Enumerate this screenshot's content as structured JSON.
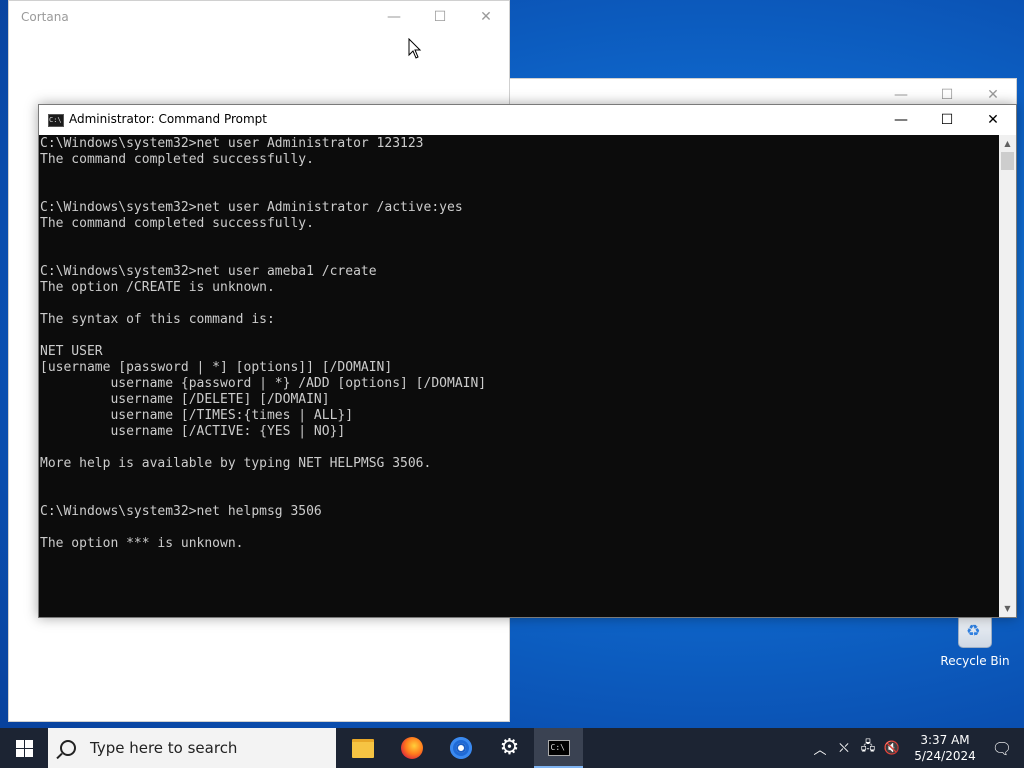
{
  "desktop": {
    "recycle_bin_label": "Recycle Bin"
  },
  "cortana_window": {
    "title": "Cortana"
  },
  "cmd_window": {
    "title": "Administrator: Command Prompt",
    "lines": [
      "C:\\Windows\\system32>net user Administrator 123123",
      "The command completed successfully.",
      "",
      "",
      "C:\\Windows\\system32>net user Administrator /active:yes",
      "The command completed successfully.",
      "",
      "",
      "C:\\Windows\\system32>net user ameba1 /create",
      "The option /CREATE is unknown.",
      "",
      "The syntax of this command is:",
      "",
      "NET USER",
      "[username [password | *] [options]] [/DOMAIN]",
      "         username {password | *} /ADD [options] [/DOMAIN]",
      "         username [/DELETE] [/DOMAIN]",
      "         username [/TIMES:{times | ALL}]",
      "         username [/ACTIVE: {YES | NO}]",
      "",
      "More help is available by typing NET HELPMSG 3506.",
      "",
      "",
      "C:\\Windows\\system32>net helpmsg 3506",
      "",
      "The option *** is unknown.",
      "",
      "",
      "",
      ""
    ],
    "prompt": "C:\\Windows\\system32>"
  },
  "taskbar": {
    "search_placeholder": "Type here to search",
    "apps": [
      {
        "name": "file-explorer",
        "icon": "folder-icon"
      },
      {
        "name": "firefox",
        "icon": "firefox-icon"
      },
      {
        "name": "chrome",
        "icon": "chrome-icon"
      },
      {
        "name": "settings",
        "icon": "gear-icon"
      },
      {
        "name": "command-prompt",
        "icon": "cmd-icon",
        "active": true
      }
    ],
    "clock": {
      "time": "3:37 AM",
      "date": "5/24/2024"
    }
  },
  "colors": {
    "console_bg": "#0c0c0c",
    "console_fg": "#cccccc",
    "taskbar_bg": "#1c2433",
    "active_indicator": "#7fb4f2"
  }
}
